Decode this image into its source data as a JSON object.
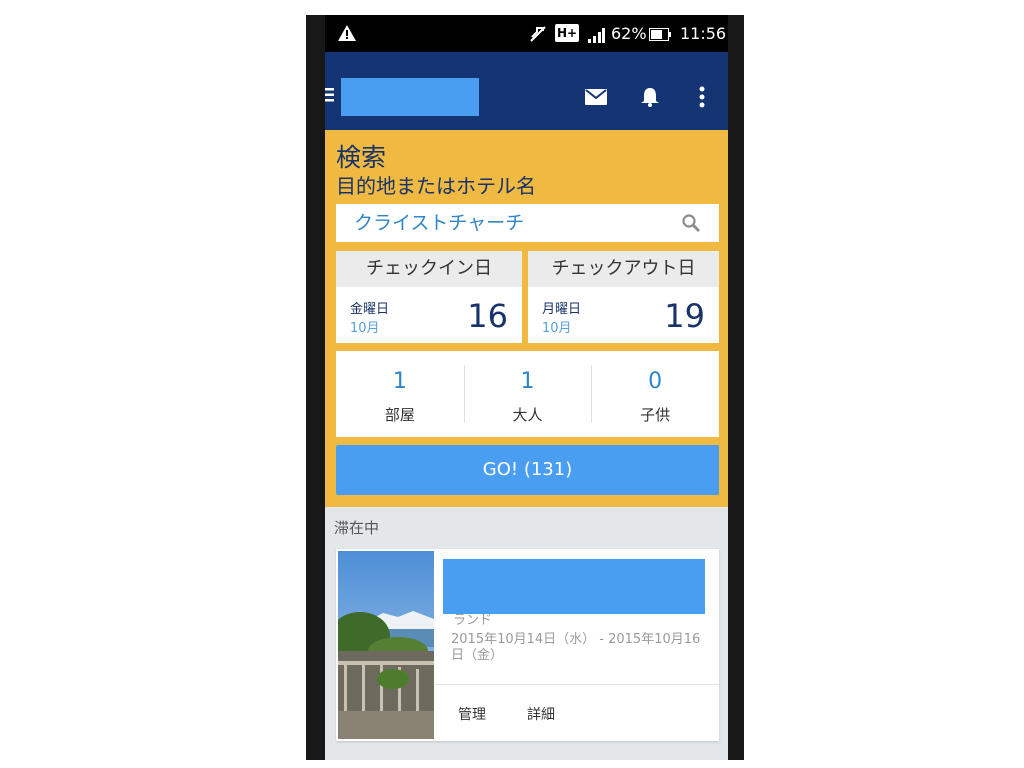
{
  "status_bar": {
    "battery_percent": "62%",
    "network": "H+",
    "time": "11:56",
    "icons": [
      "warning-icon",
      "mute-icon",
      "hplus-icon",
      "signal-icon",
      "battery-icon"
    ]
  },
  "app_bar": {
    "icons": [
      "menu-icon",
      "mail-icon",
      "bell-icon",
      "more-icon"
    ]
  },
  "search": {
    "title": "検索",
    "subtitle": "目的地またはホテル名",
    "destination_value": "クライストチャーチ"
  },
  "checkin": {
    "label": "チェックイン日",
    "weekday": "金曜日",
    "month": "10月",
    "day": "16"
  },
  "checkout": {
    "label": "チェックアウト日",
    "weekday": "月曜日",
    "month": "10月",
    "day": "19"
  },
  "guests": {
    "rooms": {
      "value": "1",
      "label": "部屋"
    },
    "adults": {
      "value": "1",
      "label": "大人"
    },
    "children": {
      "value": "0",
      "label": "子供"
    }
  },
  "go_button": {
    "label": "GO! (131)"
  },
  "stays": {
    "section_label": "滞在中",
    "card": {
      "location_fragment": "ランド",
      "dates": "2015年10月14日（水） - 2015年10月16日（金）",
      "manage_label": "管理",
      "details_label": "詳細"
    }
  },
  "colors": {
    "app_bar": "#143473",
    "search_panel": "#f0b942",
    "accent_blue": "#4a9ef2",
    "text_navy": "#17336a"
  }
}
